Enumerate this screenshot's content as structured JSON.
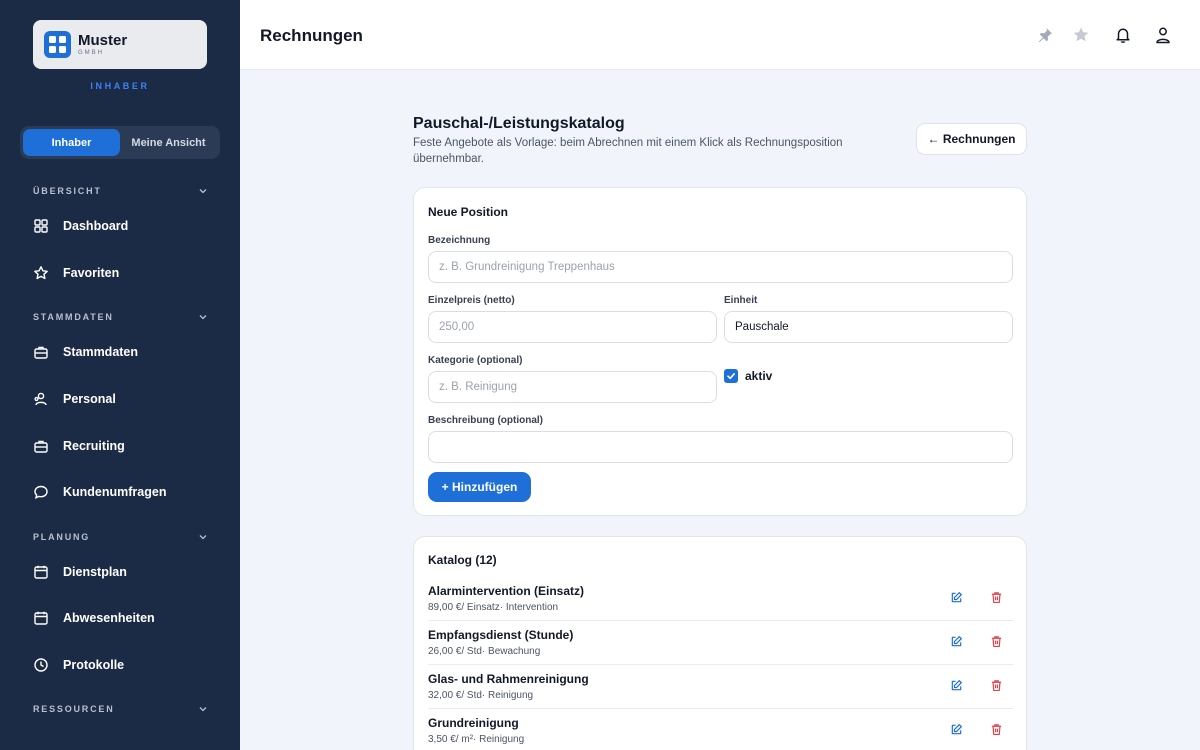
{
  "brand": {
    "name": "Muster",
    "subtitle": "GMBH",
    "role_label": "INHABER"
  },
  "view_toggle": {
    "options": [
      "Inhaber",
      "Meine Ansicht"
    ],
    "active_index": 0
  },
  "sidebar": {
    "sections": [
      {
        "title": "ÜBERSICHT",
        "items": [
          {
            "label": "Dashboard",
            "icon": "grid-icon"
          },
          {
            "label": "Favoriten",
            "icon": "star-icon"
          }
        ]
      },
      {
        "title": "STAMMDATEN",
        "items": [
          {
            "label": "Stammdaten",
            "icon": "briefcase-icon"
          },
          {
            "label": "Personal",
            "icon": "users-icon"
          },
          {
            "label": "Recruiting",
            "icon": "briefcase-icon"
          },
          {
            "label": "Kundenumfragen",
            "icon": "chat-icon"
          }
        ]
      },
      {
        "title": "PLANUNG",
        "items": [
          {
            "label": "Dienstplan",
            "icon": "calendar-icon"
          },
          {
            "label": "Abwesenheiten",
            "icon": "calendar-icon"
          },
          {
            "label": "Protokolle",
            "icon": "clock-icon"
          }
        ]
      },
      {
        "title": "RESSOURCEN",
        "items": []
      }
    ]
  },
  "header": {
    "title": "Rechnungen",
    "icons": [
      "pin-icon",
      "star-icon",
      "bell-icon",
      "user-icon"
    ]
  },
  "page": {
    "heading": "Pauschal-/Leistungskatalog",
    "description": "Feste Angebote als Vorlage: beim Abrechnen mit einem Klick als Rechnungsposition übernehmbar.",
    "back_label": "← Rechnungen"
  },
  "form": {
    "title": "Neue Position",
    "bezeichnung": {
      "label": "Bezeichnung",
      "value": "",
      "placeholder": "z. B. Grundreinigung Treppenhaus"
    },
    "einzelpreis": {
      "label": "Einzelpreis (netto)",
      "value": "",
      "placeholder": "250,00"
    },
    "einheit": {
      "label": "Einheit",
      "value": "Pauschale",
      "placeholder": ""
    },
    "kategorie": {
      "label": "Kategorie (optional)",
      "value": "",
      "placeholder": "z. B. Reinigung"
    },
    "aktiv": {
      "label": "aktiv",
      "checked": true
    },
    "beschreibung": {
      "label": "Beschreibung (optional)",
      "value": "",
      "placeholder": ""
    },
    "submit_label": "+ Hinzufügen"
  },
  "catalog": {
    "title": "Katalog (12)",
    "items": [
      {
        "name": "Alarmintervention (Einsatz)",
        "meta": "89,00 €/ Einsatz· Intervention"
      },
      {
        "name": "Empfangsdienst (Stunde)",
        "meta": "26,00 €/ Std· Bewachung"
      },
      {
        "name": "Glas- und Rahmenreinigung",
        "meta": "32,00 €/ Std· Reinigung"
      },
      {
        "name": "Grundreinigung",
        "meta": "3,50 €/ m²· Reinigung"
      }
    ]
  },
  "colors": {
    "sidebar_bg": "#1b2a45",
    "accent": "#1f6fd8",
    "danger": "#e0434b",
    "page_bg": "#f1f5fb"
  }
}
